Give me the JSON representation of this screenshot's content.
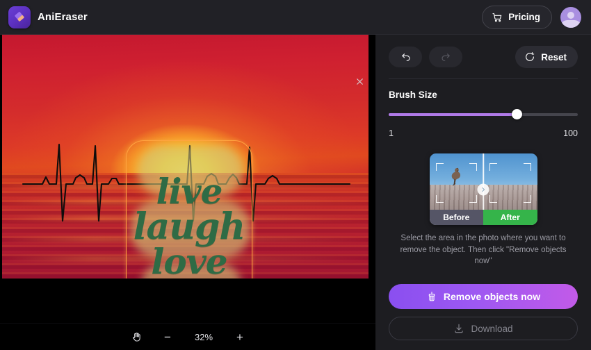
{
  "topbar": {
    "brand_name": "AniEraser",
    "logo_icon": "eraser-icon",
    "pricing_label": "Pricing",
    "pricing_icon": "shopping-cart-icon",
    "avatar_icon": "user-avatar-icon"
  },
  "editor": {
    "close_icon": "close-icon",
    "image_text_lines": [
      "live",
      "laugh",
      "love"
    ],
    "selection_border_color": "#ffa540",
    "toolbar": {
      "pan_icon": "hand-pan-icon",
      "zoom_out_label": "−",
      "zoom_level": "32%",
      "zoom_in_label": "+"
    }
  },
  "panel": {
    "undo_icon": "undo-icon",
    "redo_icon": "redo-icon",
    "reset_label": "Reset",
    "reset_icon": "reset-refresh-icon",
    "brush": {
      "title": "Brush Size",
      "min_label": "1",
      "max_label": "100",
      "value_percent": 68,
      "fill_color": "#b07ae8"
    },
    "preview": {
      "before_label": "Before",
      "after_label": "After",
      "divider_handle_icon": "chevron-right-icon",
      "after_label_color": "#35b44a",
      "before_label_color": "#555566"
    },
    "hint_text": "Select the area in the photo where you want to remove the object. Then click \"Remove objects now\"",
    "remove_button_label": "Remove objects now",
    "remove_button_icon": "brush-clean-icon",
    "download_button_label": "Download",
    "download_button_icon": "download-icon"
  }
}
